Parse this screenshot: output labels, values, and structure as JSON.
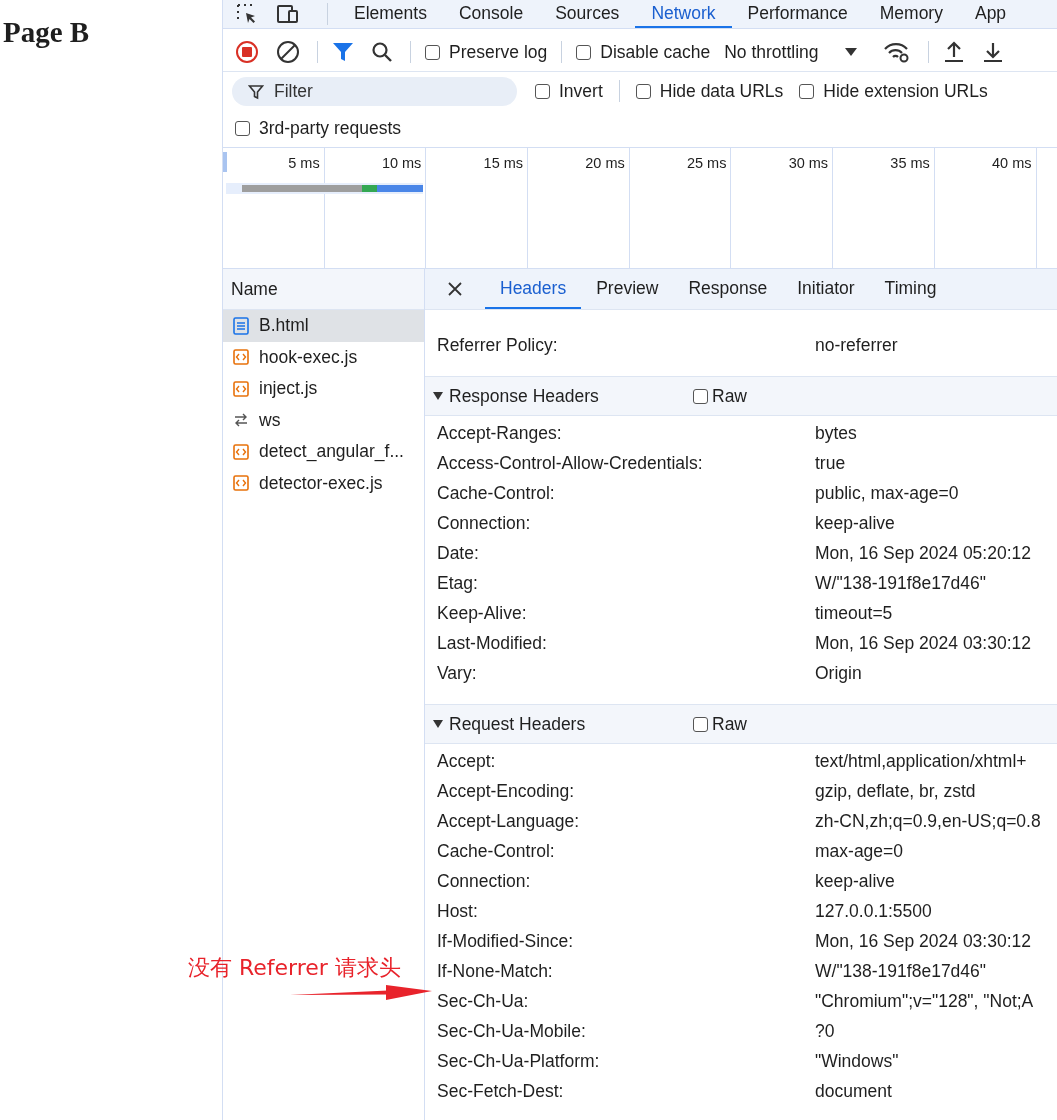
{
  "page": {
    "heading": "Page B"
  },
  "devtools": {
    "tabs": [
      {
        "label": "Elements",
        "selected": false
      },
      {
        "label": "Console",
        "selected": false
      },
      {
        "label": "Sources",
        "selected": false
      },
      {
        "label": "Network",
        "selected": true
      },
      {
        "label": "Performance",
        "selected": false
      },
      {
        "label": "Memory",
        "selected": false
      },
      {
        "label": "App",
        "selected": false
      }
    ],
    "toolbar": {
      "checkboxes": [
        {
          "label": "Preserve log",
          "checked": false
        },
        {
          "label": "Disable cache",
          "checked": false
        }
      ],
      "throttling": "No throttling"
    },
    "filter": {
      "placeholder": "Filter",
      "checkboxes": [
        {
          "label": "Invert",
          "checked": false
        },
        {
          "label": "Hide data URLs",
          "checked": false
        },
        {
          "label": "Hide extension URLs",
          "checked": false
        }
      ],
      "third_party": {
        "label": "3rd-party requests",
        "checked": false
      }
    },
    "timeline": {
      "ticks": [
        "5 ms",
        "10 ms",
        "15 ms",
        "20 ms",
        "25 ms",
        "30 ms",
        "35 ms",
        "40 ms"
      ]
    },
    "requests": {
      "column": "Name",
      "items": [
        {
          "name": "B.html",
          "kind": "document",
          "selected": true
        },
        {
          "name": "hook-exec.js",
          "kind": "script",
          "selected": false
        },
        {
          "name": "inject.js",
          "kind": "script",
          "selected": false
        },
        {
          "name": "ws",
          "kind": "websocket",
          "selected": false
        },
        {
          "name": "detect_angular_f...",
          "kind": "script",
          "selected": false
        },
        {
          "name": "detector-exec.js",
          "kind": "script",
          "selected": false
        }
      ]
    },
    "details": {
      "tabs": [
        {
          "label": "Headers",
          "selected": true
        },
        {
          "label": "Preview",
          "selected": false
        },
        {
          "label": "Response",
          "selected": false
        },
        {
          "label": "Initiator",
          "selected": false
        },
        {
          "label": "Timing",
          "selected": false
        }
      ],
      "general": [
        {
          "name": "Referrer Policy:",
          "value": "no-referrer"
        }
      ],
      "sections": [
        {
          "title": "Response Headers",
          "expanded": true,
          "raw": {
            "label": "Raw",
            "checked": false
          },
          "rows": [
            {
              "name": "Accept-Ranges:",
              "value": "bytes"
            },
            {
              "name": "Access-Control-Allow-Credentials:",
              "value": "true"
            },
            {
              "name": "Cache-Control:",
              "value": "public, max-age=0"
            },
            {
              "name": "Connection:",
              "value": "keep-alive"
            },
            {
              "name": "Date:",
              "value": "Mon, 16 Sep 2024 05:20:12"
            },
            {
              "name": "Etag:",
              "value": "W/\"138-191f8e17d46\""
            },
            {
              "name": "Keep-Alive:",
              "value": "timeout=5"
            },
            {
              "name": "Last-Modified:",
              "value": "Mon, 16 Sep 2024 03:30:12"
            },
            {
              "name": "Vary:",
              "value": "Origin"
            }
          ]
        },
        {
          "title": "Request Headers",
          "expanded": true,
          "raw": {
            "label": "Raw",
            "checked": false
          },
          "rows": [
            {
              "name": "Accept:",
              "value": "text/html,application/xhtml+"
            },
            {
              "name": "Accept-Encoding:",
              "value": "gzip, deflate, br, zstd"
            },
            {
              "name": "Accept-Language:",
              "value": "zh-CN,zh;q=0.9,en-US;q=0.8"
            },
            {
              "name": "Cache-Control:",
              "value": "max-age=0"
            },
            {
              "name": "Connection:",
              "value": "keep-alive"
            },
            {
              "name": "Host:",
              "value": "127.0.0.1:5500"
            },
            {
              "name": "If-Modified-Since:",
              "value": "Mon, 16 Sep 2024 03:30:12"
            },
            {
              "name": "If-None-Match:",
              "value": "W/\"138-191f8e17d46\""
            },
            {
              "name": "Sec-Ch-Ua:",
              "value": "\"Chromium\";v=\"128\", \"Not;A"
            },
            {
              "name": "Sec-Ch-Ua-Mobile:",
              "value": "?0"
            },
            {
              "name": "Sec-Ch-Ua-Platform:",
              "value": "\"Windows\""
            },
            {
              "name": "Sec-Fetch-Dest:",
              "value": "document"
            }
          ]
        }
      ]
    }
  },
  "annotation": {
    "text": "没有 Referrer 请求头"
  }
}
